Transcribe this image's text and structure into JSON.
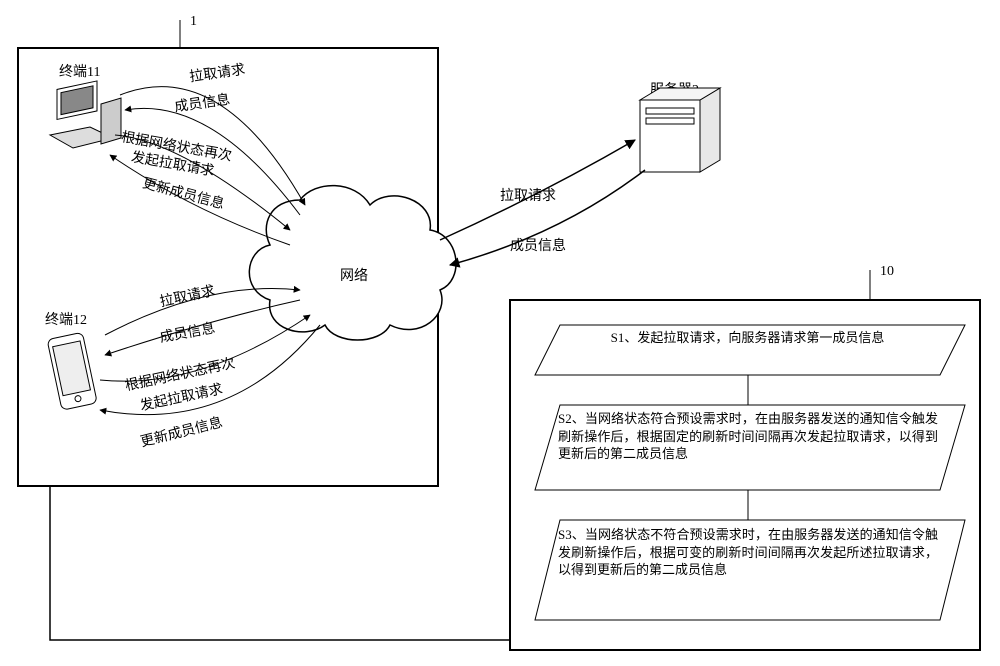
{
  "ref": {
    "system": "1",
    "flow": "10"
  },
  "labels": {
    "terminal11": "终端11",
    "terminal12": "终端12",
    "network": "网络",
    "server": "服务器2",
    "pull_request": "拉取请求",
    "member_info": "成员信息",
    "update_member_info": "更新成员信息",
    "resend_by_net_l1": "根据网络状态再次",
    "resend_by_net_l2": "发起拉取请求"
  },
  "flow": {
    "s1": "S1、发起拉取请求，向服务器请求第一成员信息",
    "s2": "S2、当网络状态符合预设需求时，在由服务器发送的通知信令触发刷新操作后，根据固定的刷新时间间隔再次发起拉取请求，以得到更新后的第二成员信息",
    "s3": "S3、当网络状态不符合预设需求时，在由服务器发送的通知信令触发刷新操作后，根据可变的刷新时间间隔再次发起所述拉取请求，以得到更新后的第二成员信息"
  }
}
